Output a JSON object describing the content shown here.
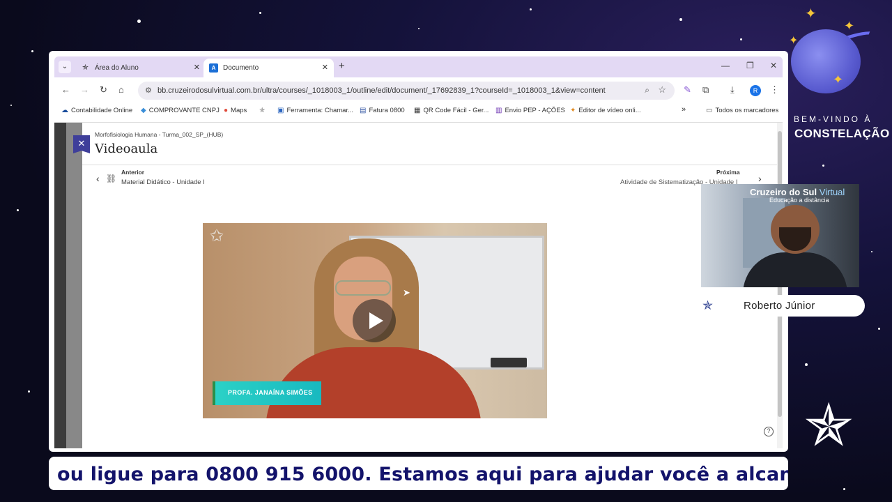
{
  "browser": {
    "tabs": [
      {
        "label": "Área do Aluno",
        "active": false
      },
      {
        "label": "Documento",
        "active": true
      }
    ],
    "url": "bb.cruzeirodosulvirtual.com.br/ultra/courses/_1018003_1/outline/edit/document/_17692839_1?courseId=_1018003_1&view=content",
    "profile_initial": "R",
    "bookmarks": [
      {
        "label": "Contabilidade Online",
        "icon": "cloud-icon"
      },
      {
        "label": "COMPROVANTE CNPJ",
        "icon": "diamond-icon"
      },
      {
        "label": "Maps",
        "icon": "map-pin-icon"
      },
      {
        "label": "",
        "icon": "star-icon"
      },
      {
        "label": "Ferramenta: Chamar...",
        "icon": "tool-icon"
      },
      {
        "label": "Fatura 0800",
        "icon": "invoice-icon"
      },
      {
        "label": "QR Code Fácil - Ger...",
        "icon": "qr-icon"
      },
      {
        "label": "Envio PEP - AÇÕES",
        "icon": "list-icon"
      },
      {
        "label": "Editor de vídeo onli...",
        "icon": "video-editor-icon"
      }
    ],
    "all_bookmarks_label": "Todos os marcadores"
  },
  "page": {
    "breadcrumb": "Morfofisiologia Humana - Turma_002_SP_(HUB)",
    "title": "Videoaula",
    "prev_label": "Anterior",
    "prev_title": "Material Didático - Unidade I",
    "next_label": "Próxima",
    "next_title": "Atividade de Sistematização - Unidade I",
    "video_caption": "PROFA. JANAÍNA SIMÕES"
  },
  "overlay": {
    "welcome_line1": "BEM-VINDO À",
    "welcome_line2": "CONSTELAÇÃO",
    "cam_brand": "Cruzeiro do Sul",
    "cam_brand_suffix": "Virtual",
    "cam_brand_sub": "Educação a distância",
    "presenter_name": "Roberto Júnior",
    "ticker": "ou ligue para 0800 915 6000. Estamos aqui para ajudar você a alcan"
  },
  "colors": {
    "tabbar": "#e3d9f4",
    "ticker_text": "#13136b",
    "close_tab_accent": "#3f3f9a",
    "caption_bg": "#2bd1c6"
  }
}
